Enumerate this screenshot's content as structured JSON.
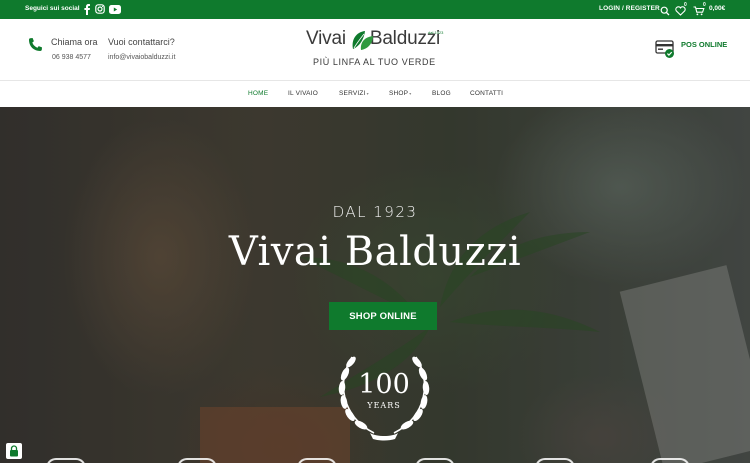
{
  "topbar": {
    "social_label": "Seguici sui social",
    "social_icons": [
      "facebook-icon",
      "instagram-icon",
      "youtube-icon"
    ],
    "login_label": "LOGIN / REGISTER",
    "wishlist_count": "0",
    "cart_count": "0",
    "cart_total": "0,00€"
  },
  "header": {
    "call_label": "Chiama ora",
    "call_number": "06 938 4577",
    "contact_label": "Vuoi contattarci?",
    "contact_email": "info@vivaiobalduzzi.it",
    "logo_part1": "Vivai",
    "logo_part2": "Balduzzi",
    "logo_since": "dal 1923",
    "logo_tagline": "PIÙ LINFA AL TUO VERDE",
    "pos_label": "POS ONLINE"
  },
  "nav": {
    "items": [
      {
        "label": "HOME"
      },
      {
        "label": "IL VIVAIO"
      },
      {
        "label": "SERVIZI"
      },
      {
        "label": "SHOP"
      },
      {
        "label": "BLOG"
      },
      {
        "label": "CONTATTI"
      }
    ],
    "active": "HOME"
  },
  "hero": {
    "since": "DAL 1923",
    "title": "Vivai Balduzzi",
    "cta": "SHOP ONLINE",
    "badge_number": "100",
    "badge_label": "YEARS"
  },
  "colors": {
    "brand_green": "#0f7a2d"
  }
}
